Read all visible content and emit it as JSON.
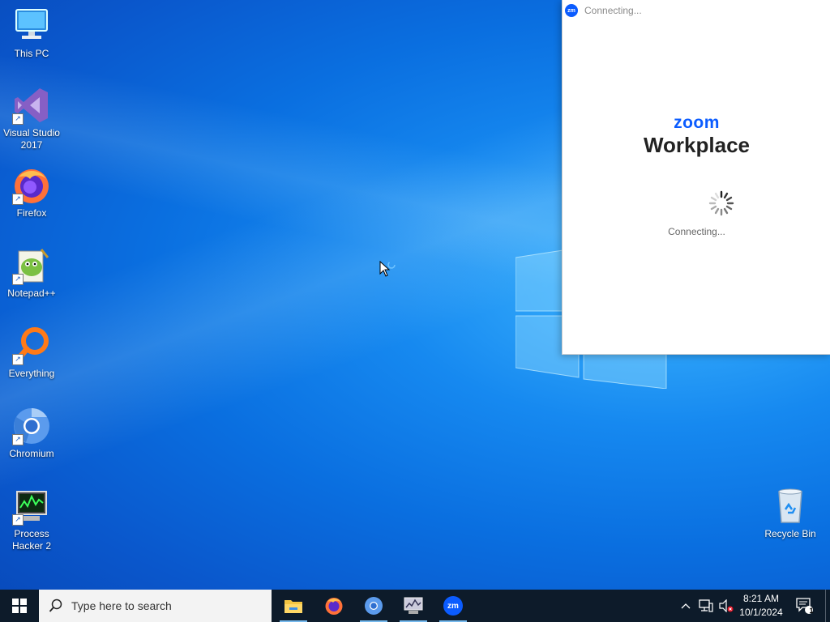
{
  "desktop": {
    "icons": [
      {
        "label": "This PC",
        "icon": "this-pc-icon"
      },
      {
        "label": "Visual Studio 2017",
        "icon": "visual-studio-icon"
      },
      {
        "label": "Firefox",
        "icon": "firefox-icon"
      },
      {
        "label": "Notepad++",
        "icon": "notepad-plus-plus-icon"
      },
      {
        "label": "Everything",
        "icon": "everything-search-icon"
      },
      {
        "label": "Chromium",
        "icon": "chromium-icon"
      },
      {
        "label": "Process Hacker 2",
        "icon": "process-hacker-icon"
      },
      {
        "label": "Recycle Bin",
        "icon": "recycle-bin-icon"
      }
    ]
  },
  "zoom_window": {
    "title": "Connecting...",
    "badge": "zm",
    "logo": "zoom",
    "product": "Workplace",
    "status": "Connecting..."
  },
  "taskbar": {
    "search_placeholder": "Type here to search",
    "apps": [
      {
        "name": "File Explorer",
        "icon": "file-explorer-icon"
      },
      {
        "name": "Firefox",
        "icon": "firefox-icon"
      },
      {
        "name": "Chromium",
        "icon": "chromium-icon"
      },
      {
        "name": "Process Hacker",
        "icon": "process-hacker-icon"
      },
      {
        "name": "Zoom",
        "icon": "zoom-icon",
        "badge": "zm"
      }
    ],
    "clock": {
      "time": "8:21 AM",
      "date": "10/1/2024"
    },
    "notification_count": "1"
  },
  "colors": {
    "zoom_blue": "#0b5cff",
    "taskbar": "#0d1b2a",
    "desktop_blue": "#0a6fe0"
  }
}
